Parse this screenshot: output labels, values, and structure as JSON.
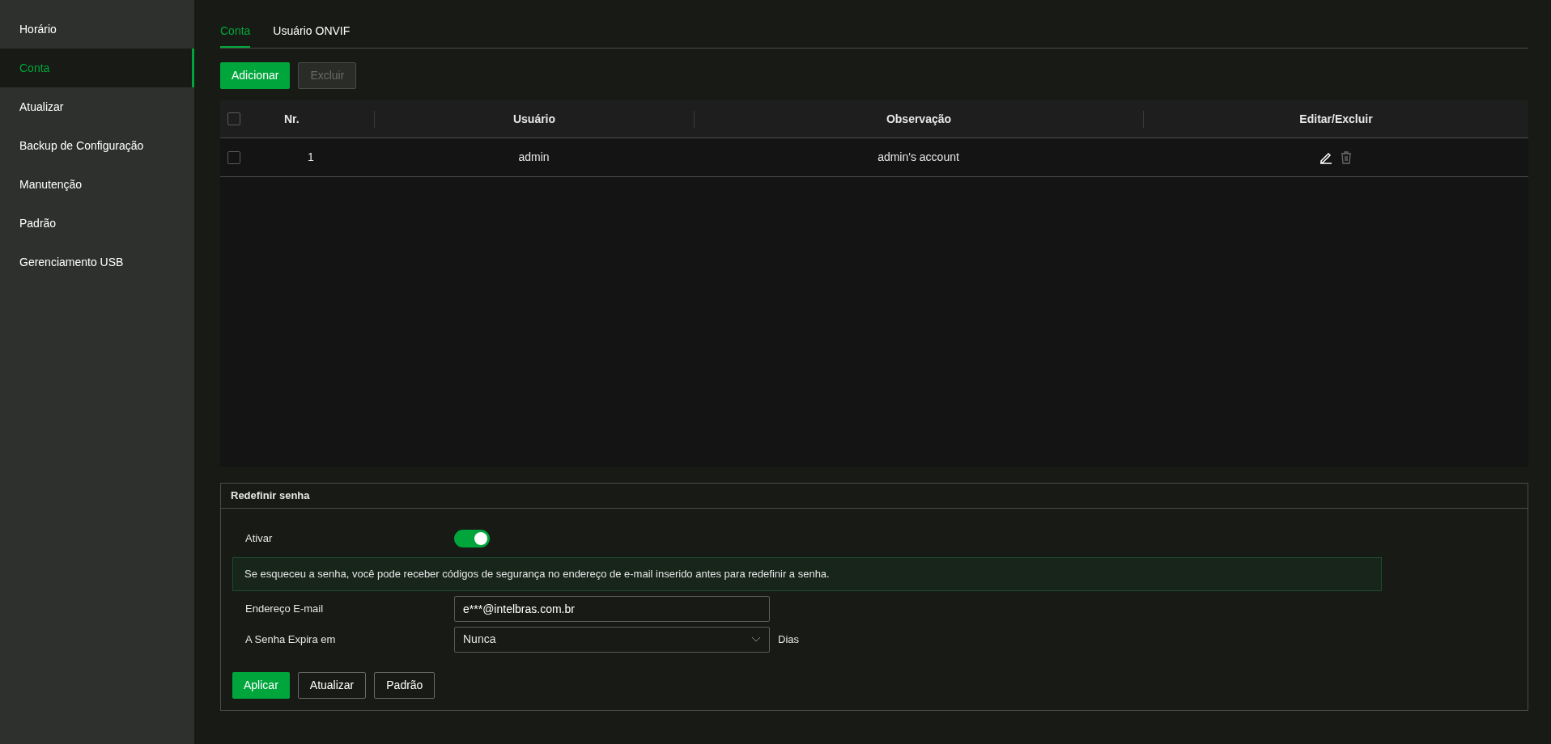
{
  "sidebar": {
    "items": [
      {
        "label": "Horário",
        "selected": false
      },
      {
        "label": "Conta",
        "selected": true
      },
      {
        "label": "Atualizar",
        "selected": false
      },
      {
        "label": "Backup de Configuração",
        "selected": false
      },
      {
        "label": "Manutenção",
        "selected": false
      },
      {
        "label": "Padrão",
        "selected": false
      },
      {
        "label": "Gerenciamento USB",
        "selected": false
      }
    ]
  },
  "tabs": [
    {
      "label": "Conta",
      "selected": true
    },
    {
      "label": "Usuário ONVIF",
      "selected": false
    }
  ],
  "toolbar": [
    {
      "label": "Adicionar",
      "disabled": false
    },
    {
      "label": "Excluir",
      "disabled": true
    }
  ],
  "table": {
    "select_all": {
      "checked": false
    },
    "columns": [
      "Nr.",
      "Usuário",
      "Observação",
      "Editar/Excluir"
    ],
    "rows": [
      {
        "checked": false,
        "cells": [
          "1",
          "admin",
          "admin's account"
        ],
        "delete_disabled": true
      }
    ]
  },
  "reset_password": {
    "title": "Redefinir senha",
    "enable": {
      "label": "Ativar",
      "on": true
    },
    "info": "Se esqueceu a senha, você pode receber códigos de segurança no endereço de e-mail inserido antes para redefinir a senha.",
    "email": {
      "label": "Endereço E-mail",
      "value": "e***@intelbras.com.br"
    },
    "expires": {
      "label": "A Senha Expira em",
      "value": "Nunca",
      "unit": "Dias"
    },
    "buttons": [
      {
        "label": "Aplicar",
        "kind": "primary"
      },
      {
        "label": "Atualizar",
        "kind": "secondary"
      },
      {
        "label": "Padrão",
        "kind": "secondary"
      }
    ]
  }
}
